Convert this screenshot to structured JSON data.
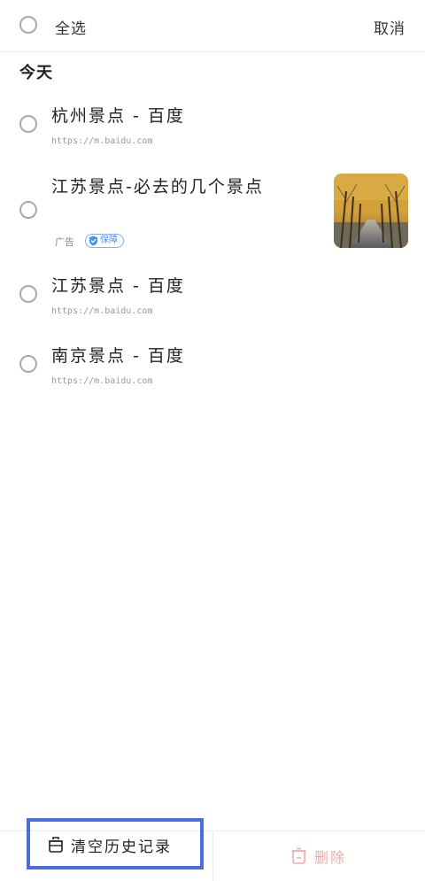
{
  "header": {
    "select_all_label": "全选",
    "cancel_label": "取消"
  },
  "section": {
    "title": "今天"
  },
  "items": [
    {
      "title": "杭州景点 - 百度",
      "url": "https://m.baidu.com"
    },
    {
      "title": "江苏景点-必去的几个景点",
      "ad_label": "广告",
      "badge": "保障"
    },
    {
      "title": "江苏景点 - 百度",
      "url": "https://m.baidu.com"
    },
    {
      "title": "南京景点 - 百度",
      "url": "https://m.baidu.com"
    }
  ],
  "footer": {
    "clear_history_label": "清空历史记录",
    "delete_label": "删除"
  },
  "colors": {
    "radio_border": "#a9a9a9",
    "badge_blue": "#4a8ef0",
    "delete_disabled": "#f4a8a8",
    "highlight_box": "#4a6ee0"
  },
  "icons": {
    "clear": "trash-bin-icon",
    "delete": "trash-icon",
    "badge": "shield-check-icon"
  }
}
